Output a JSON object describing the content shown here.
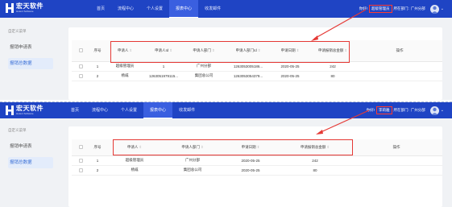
{
  "brand": {
    "title": "宏天软件",
    "subtitle": "Hotent Software"
  },
  "panels": [
    {
      "nav": [
        "首页",
        "流程中心",
        "个人设置",
        "报表中心",
        "收发邮件"
      ],
      "user": {
        "greeting": "你好!",
        "name": "超级管理员",
        "dept_label": "所在部门:",
        "dept": "广州分部"
      },
      "sidebar": {
        "title": "自定义菜单",
        "items": [
          "报销申请表",
          "报销总数据"
        ]
      },
      "table": {
        "headers": [
          "序号",
          "申请人",
          "申请人Id",
          "申请人部门",
          "申请人部门Id",
          "申请日期",
          "申请报销总金额",
          "操作"
        ],
        "rows": [
          [
            "1",
            "超级管理员",
            "1",
            "广州分部",
            "1263053005186...",
            "2020-05-25",
            "242",
            ""
          ],
          [
            "2",
            "杨威",
            "1263051979115...",
            "集团总公司",
            "1263053054379...",
            "2020-05-25",
            "80",
            ""
          ]
        ]
      }
    },
    {
      "nav": [
        "首页",
        "流程中心",
        "个人设置",
        "报表中心",
        "收发邮件"
      ],
      "user": {
        "greeting": "你好!",
        "name": "李莉雅",
        "dept_label": "所在部门:",
        "dept": "广州分部"
      },
      "sidebar": {
        "title": "自定义菜单",
        "items": [
          "报销申请表",
          "报销总数据"
        ]
      },
      "table": {
        "headers": [
          "序号",
          "申请人",
          "申请人部门",
          "申请日期",
          "申请报销总金额",
          "操作"
        ],
        "rows": [
          [
            "1",
            "超级管理员",
            "广州分部",
            "2020-05-25",
            "242",
            ""
          ],
          [
            "2",
            "杨威",
            "集团总公司",
            "2020-05-25",
            "80",
            ""
          ]
        ]
      }
    }
  ],
  "colors": {
    "topbar": "#1f44c4",
    "highlight": "#e53935",
    "active_menu": "#3a6fd6"
  }
}
